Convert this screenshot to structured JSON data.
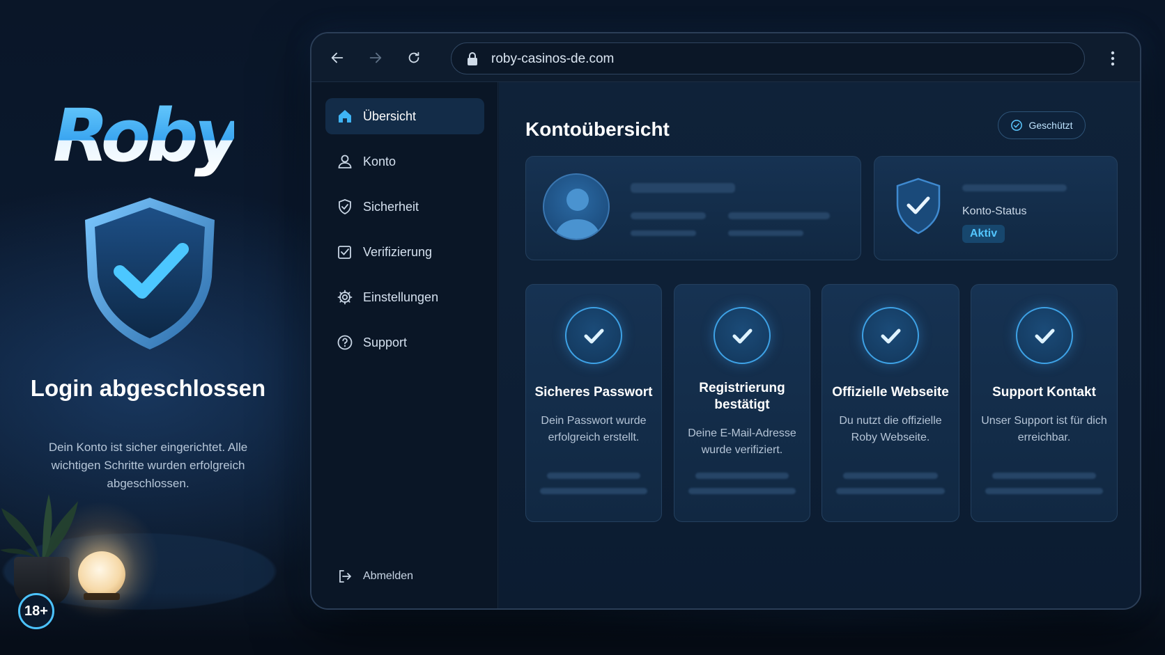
{
  "brand": {
    "logo_text": "Roby"
  },
  "hero": {
    "title": "Login abgeschlossen",
    "text": "Dein Konto ist sicher eingerichtet. Alle wichtigen Schritte wurden erfolgreich abgeschlossen.",
    "age_badge": "18+"
  },
  "browser": {
    "url": "roby-casinos-de.com",
    "icons": {
      "back": "arrow-left-icon",
      "forward": "arrow-right-icon",
      "reload": "reload-icon",
      "lock": "lock-icon",
      "menu": "more-vertical-icon"
    }
  },
  "sidebar": {
    "items": [
      {
        "label": "Übersicht",
        "icon": "home-icon",
        "active": true
      },
      {
        "label": "Konto",
        "icon": "user-icon",
        "active": false
      },
      {
        "label": "Sicherheit",
        "icon": "shield-icon",
        "active": false
      },
      {
        "label": "Verifizierung",
        "icon": "checkbox-icon",
        "active": false
      },
      {
        "label": "Einstellungen",
        "icon": "gear-icon",
        "active": false
      },
      {
        "label": "Support",
        "icon": "help-circle-icon",
        "active": false
      }
    ],
    "logout_label": "Abmelden"
  },
  "main": {
    "title": "Kontoübersicht",
    "protected_label": "Geschützt",
    "status": {
      "label": "Konto-Status",
      "value": "Aktiv"
    },
    "features": [
      {
        "title": "Sicheres Passwort",
        "text": "Dein Passwort wurde erfolgreich erstellt."
      },
      {
        "title": "Registrierung bestätigt",
        "text": "Deine E-Mail-Adresse wurde verifiziert."
      },
      {
        "title": "Offizielle Webseite",
        "text": "Du nutzt die offizielle Roby Webseite."
      },
      {
        "title": "Support Kontakt",
        "text": "Unser Support ist für dich erreichbar."
      }
    ]
  },
  "colors": {
    "accent": "#4cc3ff",
    "background": "#0a1628",
    "card": "#163252"
  }
}
